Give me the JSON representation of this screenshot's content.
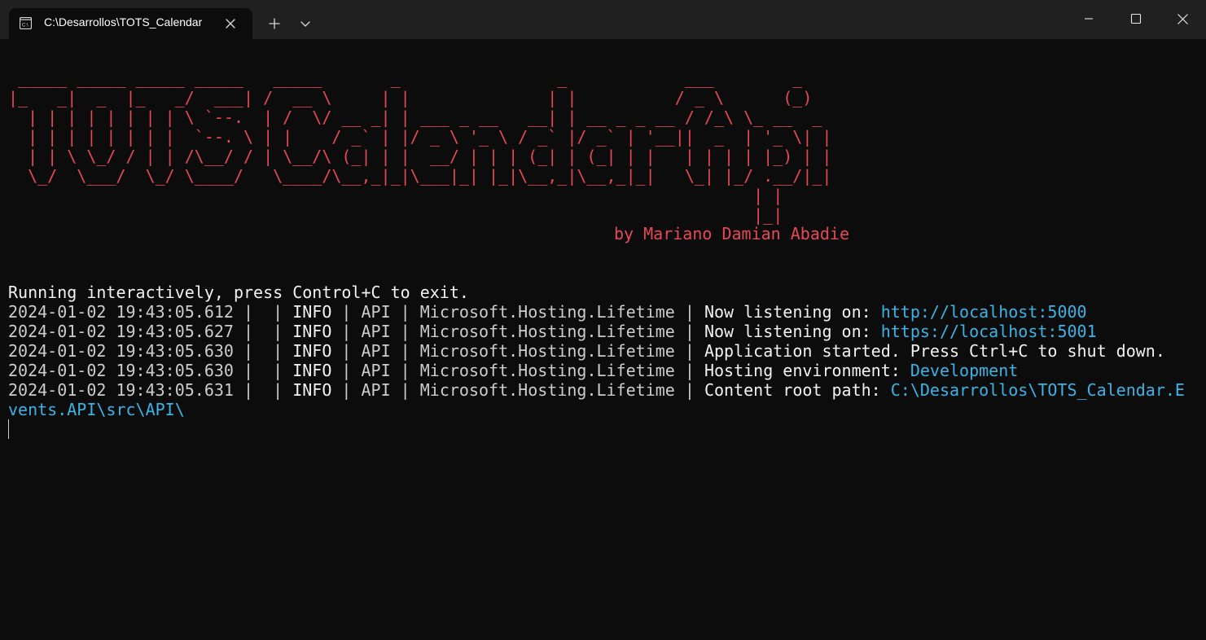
{
  "window": {
    "tab_title": "C:\\Desarrollos\\TOTS_Calendar",
    "tab_icon": "terminal-icon",
    "new_tab_icon": "plus-icon",
    "dropdown_icon": "chevron-down-icon",
    "controls": [
      "minimize-icon",
      "maximize-icon",
      "close-icon"
    ]
  },
  "colors": {
    "background": "#0c0c0c",
    "titlebar": "#202020",
    "banner": "#e74856",
    "text": "#cccccc",
    "bright_text": "#f2f2f2",
    "highlight": "#3ab4e6"
  },
  "banner": {
    "ascii": " _____ _____ _____ _____   _____       _                _            ___        _ \n|_   _|  _  |_   _/  ___| /  __ \\     | |              | |          / _ \\      (_)\n  | | | | | | | | \\ `--.  | /  \\/ __ _| | ___ _ __   __| | __ _ _ __ / /_\\ \\_ __  _ \n  | | | | | | | |  `--. \\ | |    / _` | |/ _ \\ '_ \\ / _` |/ _` | '__||  _  | '_ \\| |\n  | | \\ \\_/ / | | /\\__/ / | \\__/\\ (_| | |  __/ | | | (_| | (_| | |   | | | | |_) | |\n  \\_/  \\___/  \\_/ \\____/   \\____/\\__,_|_|\\___|_| |_|\\__,_|\\__,_|_|   \\_| |_/ .__/|_|\n                                                                            | |      \n                                                                            |_|      ",
    "byline": "by Mariano Damian Abadie"
  },
  "console": {
    "running": "Running interactively, press Control+C to exit.",
    "logs": [
      {
        "timestamp": "2024-01-02 19:43:05.612",
        "level": "INFO",
        "source": "API",
        "category": "Microsoft.Hosting.Lifetime",
        "message": "Now listening on: ",
        "value": "http://localhost:5000"
      },
      {
        "timestamp": "2024-01-02 19:43:05.627",
        "level": "INFO",
        "source": "API",
        "category": "Microsoft.Hosting.Lifetime",
        "message": "Now listening on: ",
        "value": "https://localhost:5001"
      },
      {
        "timestamp": "2024-01-02 19:43:05.630",
        "level": "INFO",
        "source": "API",
        "category": "Microsoft.Hosting.Lifetime",
        "message": "Application started. Press Ctrl+C to shut down.",
        "value": ""
      },
      {
        "timestamp": "2024-01-02 19:43:05.630",
        "level": "INFO",
        "source": "API",
        "category": "Microsoft.Hosting.Lifetime",
        "message": "Hosting environment: ",
        "value": "Development"
      },
      {
        "timestamp": "2024-01-02 19:43:05.631",
        "level": "INFO",
        "source": "API",
        "category": "Microsoft.Hosting.Lifetime",
        "message": "Content root path: ",
        "value": "C:\\Desarrollos\\TOTS_Calendar.E",
        "wrap": "vents.API\\src\\API\\"
      }
    ]
  }
}
